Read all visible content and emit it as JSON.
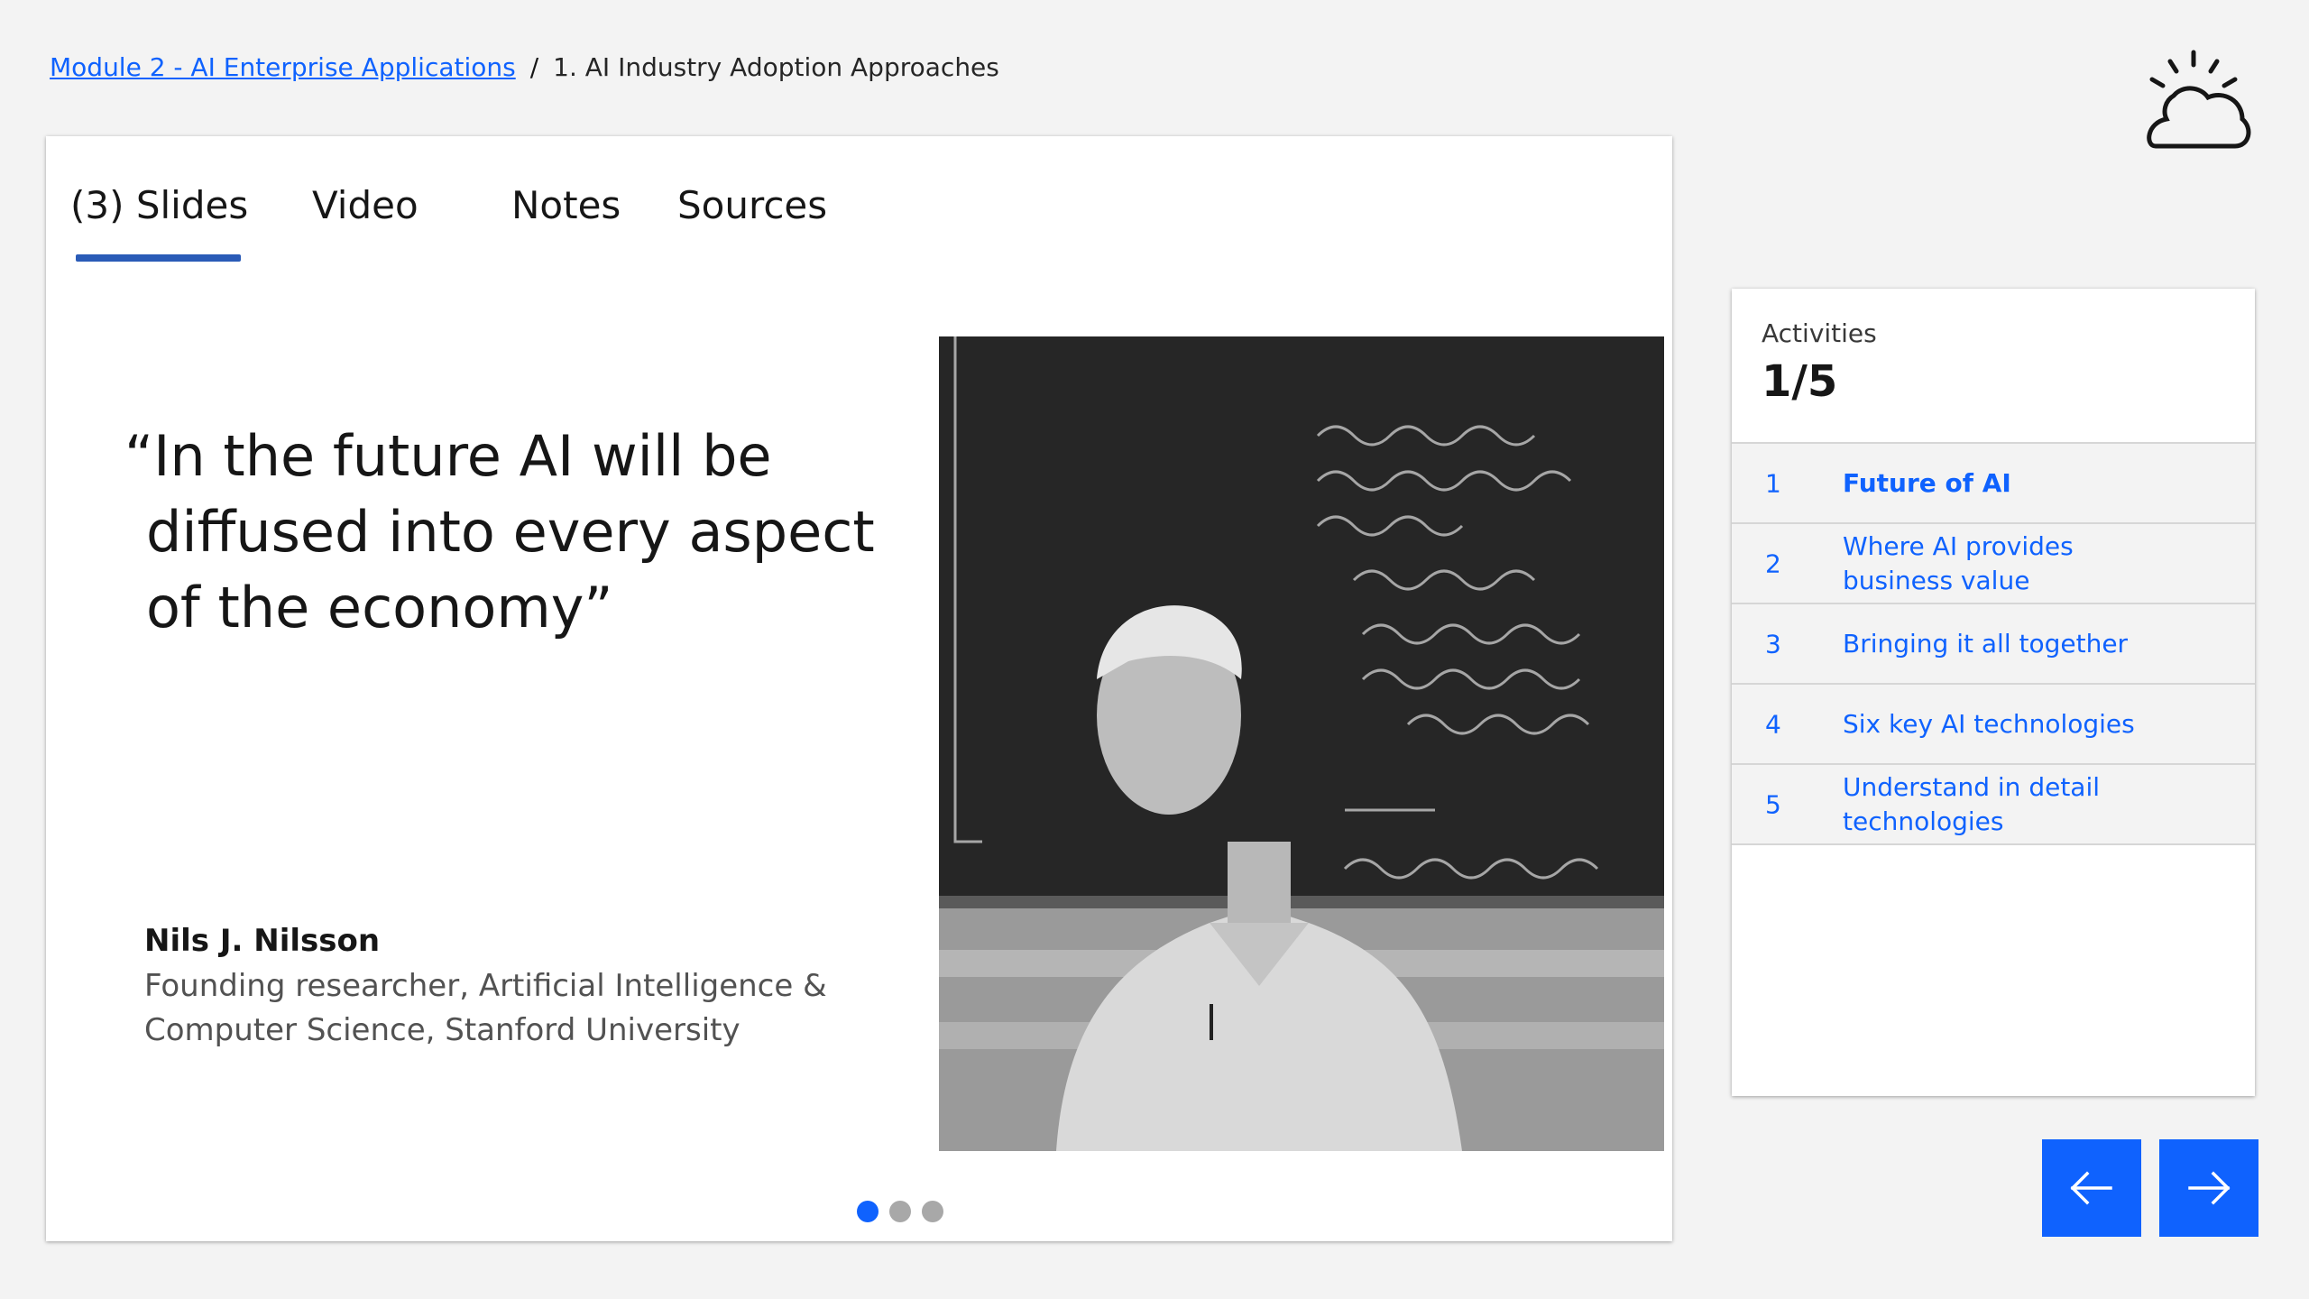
{
  "breadcrumb": {
    "parent": "Module 2 - AI Enterprise Applications",
    "separator": "/",
    "current": "1. AI Industry Adoption Approaches"
  },
  "logo_icon": "cloud-sun-icon",
  "tabs": [
    {
      "label": "(3) Slides",
      "active": true
    },
    {
      "label": "Video"
    },
    {
      "label": "Notes"
    },
    {
      "label": "Sources"
    }
  ],
  "slide": {
    "quote": "“In the future AI will be diffused into every aspect of the economy”",
    "author_name": "Nils J. Nilsson",
    "author_title": "Founding researcher, Artificial Intelligence & Computer Science, Stanford University",
    "image": "black-and-white photo of a man in front of a chalkboard",
    "pagination_total": 3,
    "pagination_active": 1
  },
  "activities": {
    "label": "Activities",
    "count": "1/5",
    "items": [
      {
        "num": "1",
        "text": "Future of AI",
        "selected": true
      },
      {
        "num": "2",
        "text": "Where AI provides business value"
      },
      {
        "num": "3",
        "text": "Bringing it all together"
      },
      {
        "num": "4",
        "text": "Six key AI technologies"
      },
      {
        "num": "5",
        "text": "Understand in detail technologies"
      }
    ]
  },
  "nav": {
    "prev_icon": "arrow-left-icon",
    "next_icon": "arrow-right-icon"
  },
  "colors": {
    "accent": "#0f62fe",
    "tab_underline": "#2a5bb7",
    "background": "#f3f3f3"
  }
}
